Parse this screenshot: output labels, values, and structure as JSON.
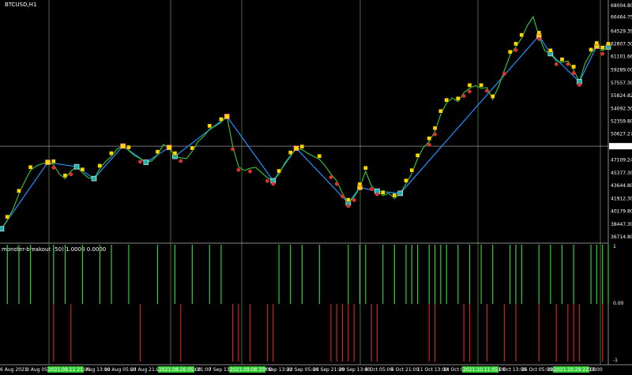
{
  "window": {
    "symbol_title": "BTCUSD,H1"
  },
  "indicator": {
    "label": "monster-breakout (50) 1.0000 0.0000"
  },
  "current_price": "48978.76",
  "price_axis": [
    "68004.80",
    "66464.75",
    "64529.39",
    "62807.30",
    "61101.66",
    "59289.00",
    "57557.30",
    "55824.82",
    "54092.30",
    "52359.80",
    "50627.27",
    "48978.76",
    "47109.24",
    "45377.30",
    "43644.80",
    "41912.30",
    "40179.80",
    "38447.30",
    "36714.80"
  ],
  "indicator_axis": [
    "1",
    "0.00",
    "-1"
  ],
  "time_axis": [
    "6 Aug 2021",
    "9 Aug 05:00",
    "11 Aug 21:00",
    "16 Aug 13:00",
    "19 Aug 05:00",
    "23 Aug 21:00",
    "26 Aug 05:00",
    "2 Sep 21:00",
    "7 Sep 13:00",
    "14 Sep 21:00",
    "17 Sep 13:00",
    "22 Sep 05:00",
    "24 Sep 21:00",
    "29 Sep 13:00",
    "4 Oct 05:00",
    "6 Oct 21:00",
    "11 Oct 13:00",
    "14 Oct 05:00",
    "18 Oct 21:00",
    "21 Oct 13:00",
    "26 Oct 05:00",
    "28 Oct 21:00",
    "2 Nov 13:00"
  ],
  "highlighted_time_labels": [
    "2021.08.11 21:00",
    "2021.08.26 05:00",
    "2021.09.08 10:00",
    "2021.10.11 05:00",
    "2021.10.29 22:00"
  ],
  "colors": {
    "background": "#000000",
    "price_line": "#32cd32",
    "zigzag": "#1e90ff",
    "grid_vertical": "#6aa84f",
    "buy_signal": "#32cd32",
    "sell_signal": "#cc2222",
    "axis_text": "#ffffff",
    "highlight_label": "#32cd32",
    "marker_high": "#ffd700",
    "marker_low": "#20b2aa",
    "marker_mid": "#ff69b4",
    "marker_red": "#e03030"
  },
  "chart_data": {
    "type": "line",
    "series": [
      {
        "values": [
          37800,
          39000,
          40500,
          42500,
          44200,
          45700,
          46300,
          46600,
          46800,
          46500,
          45200,
          44600,
          45600,
          46200,
          45400,
          44700,
          44600,
          45900,
          46900,
          47600,
          48600,
          49000,
          48400,
          47700,
          47300,
          46800,
          47000,
          47800,
          49200,
          48800,
          47600,
          47400,
          47300,
          48300,
          49600,
          50300,
          51300,
          51700,
          52200,
          53000,
          49000,
          46200,
          45700,
          46000,
          46100,
          45400,
          44700,
          44300,
          45200,
          46700,
          47700,
          48700,
          48500,
          48000,
          47600,
          47200,
          46300,
          45200,
          44300,
          42600,
          41300,
          42100,
          43400,
          45600,
          43600,
          42900,
          42300,
          42600,
          41900,
          42600,
          43900,
          45300,
          47300,
          48800,
          49600,
          51000,
          53300,
          54800,
          55500,
          55000,
          56200,
          56800,
          57200,
          56800,
          56900,
          55300,
          57000,
          59200,
          61300,
          62400,
          63600,
          65300,
          66500,
          63900,
          61900,
          61500,
          60500,
          60300,
          60500,
          59300,
          57700,
          60200,
          61600,
          62500,
          61900,
          62400
        ]
      }
    ],
    "ylim": [
      36714.8,
      68004.8
    ],
    "y_scale": "linear",
    "grid": false,
    "signals": {
      "buy": [
        1,
        3,
        5,
        9,
        11,
        14,
        17,
        19,
        22,
        27,
        30,
        33,
        36,
        38,
        48,
        50,
        52,
        55,
        60,
        62,
        63,
        66,
        68,
        70,
        71,
        72,
        74,
        75,
        76,
        77,
        79,
        81,
        83,
        85,
        88,
        89,
        90,
        93,
        95,
        97,
        99,
        102,
        103,
        104,
        105
      ],
      "sell": [
        9,
        12,
        24,
        31,
        40,
        41,
        43,
        46,
        47,
        57,
        58,
        59,
        60,
        61,
        64,
        65,
        74,
        75,
        80,
        81,
        84,
        87,
        89,
        93,
        96,
        98,
        99,
        100,
        104
      ]
    }
  }
}
